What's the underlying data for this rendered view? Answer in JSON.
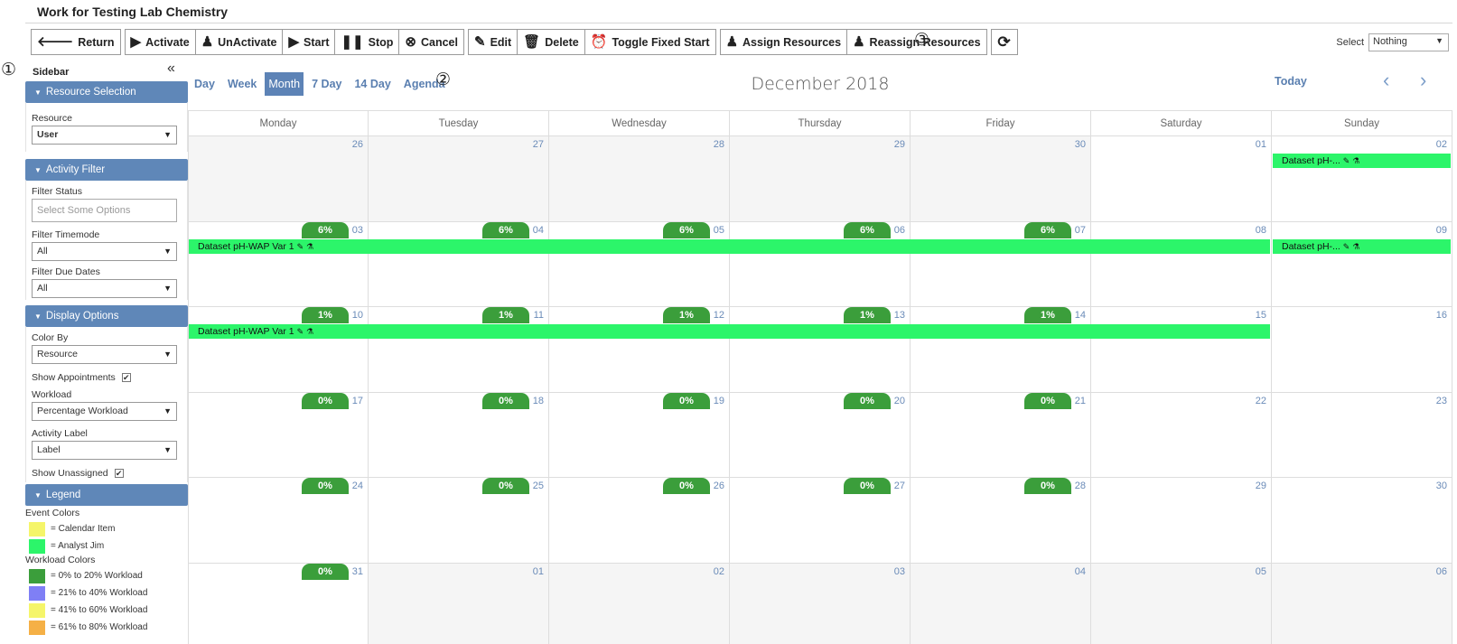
{
  "title": "Work for Testing Lab Chemistry",
  "toolbar": {
    "return": "Return",
    "activate": "Activate",
    "unactivate": "UnActivate",
    "start": "Start",
    "stop": "Stop",
    "cancel": "Cancel",
    "edit": "Edit",
    "delete": "Delete",
    "toggle_fixed_start": "Toggle Fixed Start",
    "assign_resources": "Assign Resources",
    "reassign_resources": "Reassign Resources",
    "select_label": "Select",
    "select_value": "Nothing"
  },
  "markers": {
    "one": "①",
    "two": "②",
    "three": "③"
  },
  "sidebar": {
    "title": "Sidebar",
    "resource_selection": {
      "header": "Resource Selection",
      "resource_label": "Resource",
      "resource_value": "User"
    },
    "activity_filter": {
      "header": "Activity Filter",
      "filter_status_label": "Filter Status",
      "filter_status_placeholder": "Select Some Options",
      "filter_timemode_label": "Filter Timemode",
      "filter_timemode_value": "All",
      "filter_due_dates_label": "Filter Due Dates",
      "filter_due_dates_value": "All"
    },
    "display_options": {
      "header": "Display Options",
      "color_by_label": "Color By",
      "color_by_value": "Resource",
      "show_appointments_label": "Show Appointments",
      "workload_label": "Workload",
      "workload_value": "Percentage Workload",
      "activity_label_label": "Activity Label",
      "activity_label_value": "Label",
      "show_unassigned_label": "Show Unassigned"
    },
    "legend": {
      "header": "Legend",
      "event_colors_label": "Event Colors",
      "event_colors": [
        {
          "label": "= Calendar Item",
          "color": "#f5f56a"
        },
        {
          "label": "= Analyst Jim",
          "color": "#2cf56a"
        }
      ],
      "workload_colors_label": "Workload Colors",
      "workload_colors": [
        {
          "label": "= 0% to 20% Workload",
          "color": "#3b9e3b"
        },
        {
          "label": "= 21% to 40% Workload",
          "color": "#7f7ff5"
        },
        {
          "label": "= 41% to 60% Workload",
          "color": "#f5f56a"
        },
        {
          "label": "= 61% to 80% Workload",
          "color": "#f5b046"
        }
      ]
    }
  },
  "calendar": {
    "views": [
      "Day",
      "Week",
      "Month",
      "7 Day",
      "14 Day",
      "Agenda"
    ],
    "active_view": "Month",
    "month_title": "December 2018",
    "today_label": "Today",
    "prev_icon": "‹",
    "next_icon": "›",
    "weekdays": [
      "Monday",
      "Tuesday",
      "Wednesday",
      "Thursday",
      "Friday",
      "Saturday",
      "Sunday"
    ],
    "weeks": [
      {
        "days": [
          "26",
          "27",
          "28",
          "29",
          "30",
          "01",
          "02"
        ],
        "other": [
          true,
          true,
          true,
          true,
          true,
          false,
          false
        ],
        "workload": [
          "",
          "",
          "",
          "",
          "",
          "",
          ""
        ]
      },
      {
        "days": [
          "03",
          "04",
          "05",
          "06",
          "07",
          "08",
          "09"
        ],
        "other": [
          false,
          false,
          false,
          false,
          false,
          false,
          false
        ],
        "workload": [
          "6%",
          "6%",
          "6%",
          "6%",
          "6%",
          "",
          ""
        ]
      },
      {
        "days": [
          "10",
          "11",
          "12",
          "13",
          "14",
          "15",
          "16"
        ],
        "other": [
          false,
          false,
          false,
          false,
          false,
          false,
          false
        ],
        "workload": [
          "1%",
          "1%",
          "1%",
          "1%",
          "1%",
          "",
          ""
        ]
      },
      {
        "days": [
          "17",
          "18",
          "19",
          "20",
          "21",
          "22",
          "23"
        ],
        "other": [
          false,
          false,
          false,
          false,
          false,
          false,
          false
        ],
        "workload": [
          "0%",
          "0%",
          "0%",
          "0%",
          "0%",
          "",
          ""
        ]
      },
      {
        "days": [
          "24",
          "25",
          "26",
          "27",
          "28",
          "29",
          "30"
        ],
        "other": [
          false,
          false,
          false,
          false,
          false,
          false,
          false
        ],
        "workload": [
          "0%",
          "0%",
          "0%",
          "0%",
          "0%",
          "",
          ""
        ]
      },
      {
        "days": [
          "31",
          "01",
          "02",
          "03",
          "04",
          "05",
          "06"
        ],
        "other": [
          false,
          true,
          true,
          true,
          true,
          true,
          true
        ],
        "workload": [
          "0%",
          "",
          "",
          "",
          "",
          "",
          ""
        ]
      }
    ],
    "events": [
      {
        "label": "Dataset pH-...",
        "week": 0,
        "start": 6,
        "span": 1
      },
      {
        "label": "Dataset pH-WAP Var 1",
        "week": 1,
        "start": 0,
        "span": 6
      },
      {
        "label": "Dataset pH-...",
        "week": 1,
        "start": 6,
        "span": 1
      },
      {
        "label": "Dataset pH-WAP Var 1",
        "week": 2,
        "start": 0,
        "span": 6
      }
    ]
  }
}
